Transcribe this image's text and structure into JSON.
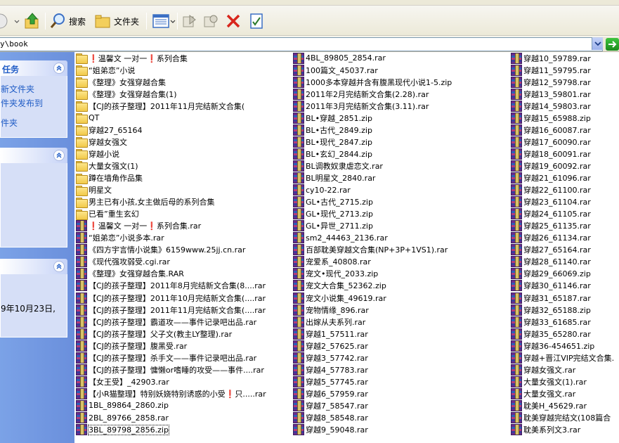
{
  "address": {
    "path": "y\\book"
  },
  "toolbar": {
    "search_label": "搜索",
    "folders_label": "文件夹"
  },
  "taskpane": {
    "panel1": {
      "title": "任务",
      "links": [
        "新文件夹",
        "件夹发布到",
        "件夹"
      ]
    },
    "panel3": {
      "date_text": "9年10月23日,"
    }
  },
  "columns": [
    [
      {
        "type": "folder",
        "name": "❗温馨文 一对一❗系列合集"
      },
      {
        "type": "folder",
        "name": "“姐弟恋”小说"
      },
      {
        "type": "folder",
        "name": "《整理》女强穿越合集"
      },
      {
        "type": "folder",
        "name": "《整理》女强穿越合集(1)"
      },
      {
        "type": "folder",
        "name": "【CJ的孩子整理】2011年11月完结新文合集("
      },
      {
        "type": "folder",
        "name": "QT"
      },
      {
        "type": "folder",
        "name": "穿越27_65164"
      },
      {
        "type": "folder",
        "name": "穿越女强文"
      },
      {
        "type": "folder",
        "name": "穿越小说"
      },
      {
        "type": "folder",
        "name": "大量女强文(1)"
      },
      {
        "type": "folder",
        "name": "蹲在墙角作品集"
      },
      {
        "type": "folder",
        "name": "明星文"
      },
      {
        "type": "folder",
        "name": "男主已有小孩,女主做后母的系列合集"
      },
      {
        "type": "folder",
        "name": "已看”重生玄幻"
      },
      {
        "type": "rar",
        "name": "❗温馨文 一对一❗系列合集.rar"
      },
      {
        "type": "rar",
        "name": "“姐弟恋”小说多本.rar"
      },
      {
        "type": "rar",
        "name": "《四方宇言情小说集》6159www.25jj.cn.rar"
      },
      {
        "type": "rar",
        "name": "《现代强攻弱受.cgi.rar"
      },
      {
        "type": "rar",
        "name": "《整理》女强穿越合集.RAR"
      },
      {
        "type": "rar",
        "name": "【CJ的孩子整理】2011年8月完结新文合集(8....rar"
      },
      {
        "type": "rar",
        "name": "【CJ的孩子整理】2011年10月完结新文合集(....rar"
      },
      {
        "type": "rar",
        "name": "【CJ的孩子整理】2011年11月完结新文合集(....rar"
      },
      {
        "type": "rar",
        "name": "【CJ的孩子整理】霸道攻——事件记录吧出品.rar"
      },
      {
        "type": "rar",
        "name": "【CJ的孩子整理】父子文(教主LY整理).rar"
      },
      {
        "type": "rar",
        "name": "【CJ的孩子整理】腹黑受.rar"
      },
      {
        "type": "rar",
        "name": "【CJ的孩子整理】杀手文——事件记录吧出品.rar"
      },
      {
        "type": "rar",
        "name": "【CJ的孩子整理】慵懒or嗜睡的攻受——事件....rar"
      },
      {
        "type": "rar",
        "name": "【女王受】_42903.rar"
      },
      {
        "type": "rar",
        "name": "【小R猫整理】特别妖娆特别诱惑的小受❗只.....rar"
      },
      {
        "type": "rar",
        "name": "1BL_89864_2860.zip"
      },
      {
        "type": "rar",
        "name": "2BL_89766_2858.rar"
      },
      {
        "type": "rar",
        "name": "3BL_89798_2856.zip",
        "selected": true
      }
    ],
    [
      {
        "type": "rar",
        "name": "4BL_89805_2854.rar"
      },
      {
        "type": "rar",
        "name": "100篇文_45037.rar"
      },
      {
        "type": "rar",
        "name": "1000多本穿越并含有腹黑现代小说1-5.zip"
      },
      {
        "type": "rar",
        "name": "2011年2月完结新文合集(2.28).rar"
      },
      {
        "type": "rar",
        "name": "2011年3月完结新文合集(3.11).rar"
      },
      {
        "type": "rar",
        "name": "BL•穿越_2851.zip"
      },
      {
        "type": "rar",
        "name": "BL•古代_2849.zip"
      },
      {
        "type": "rar",
        "name": "BL•现代_2847.zip"
      },
      {
        "type": "rar",
        "name": "BL•玄幻_2844.zip"
      },
      {
        "type": "rar",
        "name": "BL调教奴隶虐恋文.rar"
      },
      {
        "type": "rar",
        "name": "BL明星文_2840.rar"
      },
      {
        "type": "rar",
        "name": "cy10-22.rar"
      },
      {
        "type": "rar",
        "name": "GL•古代_2715.zip"
      },
      {
        "type": "rar",
        "name": "GL•现代_2713.zip"
      },
      {
        "type": "rar",
        "name": "GL•异世_2711.zip"
      },
      {
        "type": "rar",
        "name": "sm2_44463_2136.rar"
      },
      {
        "type": "rar",
        "name": "百部耽美穿越文合集(NP+3P+1VS1).rar"
      },
      {
        "type": "rar",
        "name": "宠爱系_40808.rar"
      },
      {
        "type": "rar",
        "name": "宠文•现代_2033.zip"
      },
      {
        "type": "rar",
        "name": "宠文大合集_52362.zip"
      },
      {
        "type": "rar",
        "name": "宠文小说集_49619.rar"
      },
      {
        "type": "rar",
        "name": "宠物情缘_896.rar"
      },
      {
        "type": "rar",
        "name": "出嫁从夫系列.rar"
      },
      {
        "type": "rar",
        "name": "穿越1_57511.rar"
      },
      {
        "type": "rar",
        "name": "穿越2_57625.rar"
      },
      {
        "type": "rar",
        "name": "穿越3_57742.rar"
      },
      {
        "type": "rar",
        "name": "穿越4_57783.rar"
      },
      {
        "type": "rar",
        "name": "穿越5_57745.rar"
      },
      {
        "type": "rar",
        "name": "穿越6_57959.rar"
      },
      {
        "type": "rar",
        "name": "穿越7_58547.rar"
      },
      {
        "type": "rar",
        "name": "穿越8_58548.rar"
      },
      {
        "type": "rar",
        "name": "穿越9_59048.rar"
      }
    ],
    [
      {
        "type": "rar",
        "name": "穿越10_59789.rar"
      },
      {
        "type": "rar",
        "name": "穿越11_59795.rar"
      },
      {
        "type": "rar",
        "name": "穿越12_59798.rar"
      },
      {
        "type": "rar",
        "name": "穿越13_59801.rar"
      },
      {
        "type": "rar",
        "name": "穿越14_59803.rar"
      },
      {
        "type": "rar",
        "name": "穿越15_65988.zip"
      },
      {
        "type": "rar",
        "name": "穿越16_60087.rar"
      },
      {
        "type": "rar",
        "name": "穿越17_60090.rar"
      },
      {
        "type": "rar",
        "name": "穿越18_60091.rar"
      },
      {
        "type": "rar",
        "name": "穿越19_60092.rar"
      },
      {
        "type": "rar",
        "name": "穿越21_61096.rar"
      },
      {
        "type": "rar",
        "name": "穿越22_61100.rar"
      },
      {
        "type": "rar",
        "name": "穿越23_61104.rar"
      },
      {
        "type": "rar",
        "name": "穿越24_61105.rar"
      },
      {
        "type": "rar",
        "name": "穿越25_61135.rar"
      },
      {
        "type": "rar",
        "name": "穿越26_61134.rar"
      },
      {
        "type": "rar",
        "name": "穿越27_65164.rar"
      },
      {
        "type": "rar",
        "name": "穿越28_61140.rar"
      },
      {
        "type": "rar",
        "name": "穿越29_66069.zip"
      },
      {
        "type": "rar",
        "name": "穿越30_61146.rar"
      },
      {
        "type": "rar",
        "name": "穿越31_65187.rar"
      },
      {
        "type": "rar",
        "name": "穿越32_65188.zip"
      },
      {
        "type": "rar",
        "name": "穿越33_61685.rar"
      },
      {
        "type": "rar",
        "name": "穿越35_65280.rar"
      },
      {
        "type": "rar",
        "name": "穿越36-454651.zip"
      },
      {
        "type": "rar",
        "name": "穿越+晋江VIP完结文合集."
      },
      {
        "type": "rar",
        "name": "穿越女强文.rar"
      },
      {
        "type": "rar",
        "name": "大量女强文(1).rar"
      },
      {
        "type": "rar",
        "name": "大量女强文.rar"
      },
      {
        "type": "rar",
        "name": "耽美H_45629.rar"
      },
      {
        "type": "rar",
        "name": "耽美穿越完结文(108篇合"
      },
      {
        "type": "rar",
        "name": "耽美系列文3.rar"
      }
    ]
  ]
}
